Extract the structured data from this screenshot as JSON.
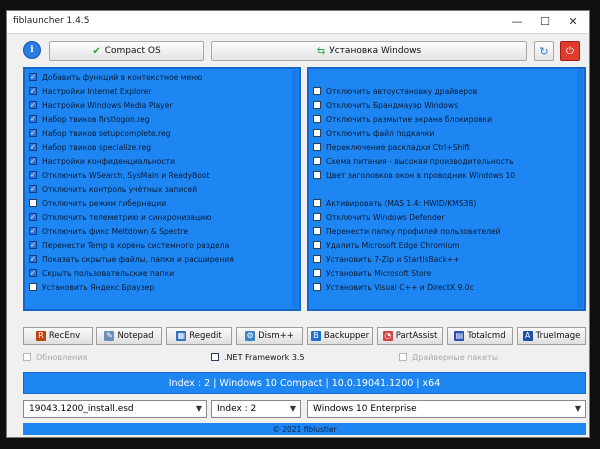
{
  "window": {
    "title": "fiblauncher 1.4.5"
  },
  "top": {
    "compact_label": "Compact OS",
    "install_label": "Установка Windows"
  },
  "left_items": [
    {
      "label": "Добавить функций в контекстное меню",
      "checked": true
    },
    {
      "label": "Настройки Internet Explorer",
      "checked": true
    },
    {
      "label": "Настройки Windows Media Player",
      "checked": true
    },
    {
      "label": "Набор твиков firstlogon.reg",
      "checked": true
    },
    {
      "label": "Набор твиков setupcomplete.reg",
      "checked": true
    },
    {
      "label": "Набор твиков specialize.reg",
      "checked": true
    },
    {
      "label": "Настройки конфиденциальности",
      "checked": true
    },
    {
      "label": "Отключить WSearch, SysMain и ReadyBoot",
      "checked": true
    },
    {
      "label": "Отключить контроль учётных записей",
      "checked": true
    },
    {
      "label": "Отключить режим гибернации",
      "checked": false
    },
    {
      "label": "Отключить телеметрию и синхронизацию",
      "checked": true
    },
    {
      "label": "Отключить фикс Meltdown & Spectre",
      "checked": true
    },
    {
      "label": "Перенести Temp в корень системного раздела",
      "checked": true
    },
    {
      "label": "Показать скрытые файлы, папки и расширения",
      "checked": true
    },
    {
      "label": "Скрыть пользовательские папки",
      "checked": true
    },
    {
      "label": "Установить Яндекс Браузер",
      "checked": false
    }
  ],
  "right_items": [
    {
      "label": "Отключить автоустановку драйверов",
      "checked": false
    },
    {
      "label": "Отключить Брандмауэр Windows",
      "checked": false
    },
    {
      "label": "Отключить размытие экрана блокировки",
      "checked": false
    },
    {
      "label": "Отключить файл подкачки",
      "checked": false
    },
    {
      "label": "Переключение раскладки Ctrl+Shift",
      "checked": false
    },
    {
      "label": "Схема питания - высокая производительность",
      "checked": false
    },
    {
      "label": "Цвет заголовков окон в проводник Windows 10",
      "checked": false
    },
    {
      "label": "Активировать (MAS 1.4: HWID/KMS38)",
      "checked": false
    },
    {
      "label": "Отключить Windows Defender",
      "checked": false
    },
    {
      "label": "Перенести папку профилей пользователей",
      "checked": false
    },
    {
      "label": "Удалить Microsoft Edge Chromium",
      "checked": false
    },
    {
      "label": "Установить 7-Zip и StartIsBack++",
      "checked": false
    },
    {
      "label": "Установить Microsoft Store",
      "checked": false
    },
    {
      "label": "Установить Visual C++ и DirectX 9.0c",
      "checked": false
    }
  ],
  "tools": [
    "RecEnv",
    "Notepad",
    "Regedit",
    "Dism++",
    "Backupper",
    "PartAssist",
    "Totalcmd",
    "TrueImage"
  ],
  "options": {
    "opt1": "Обновления",
    "opt2": ".NET Framework 3.5",
    "opt3": "Драйверные пакеты"
  },
  "status_text": "Index : 2 | Windows 10 Compact | 10.0.19041.1200 | x64",
  "selects": {
    "image": "19043.1200_install.esd",
    "index": "Index : 2",
    "edition": "Windows 10 Enterprise"
  },
  "footer_text": "© 2021 fiblustier"
}
